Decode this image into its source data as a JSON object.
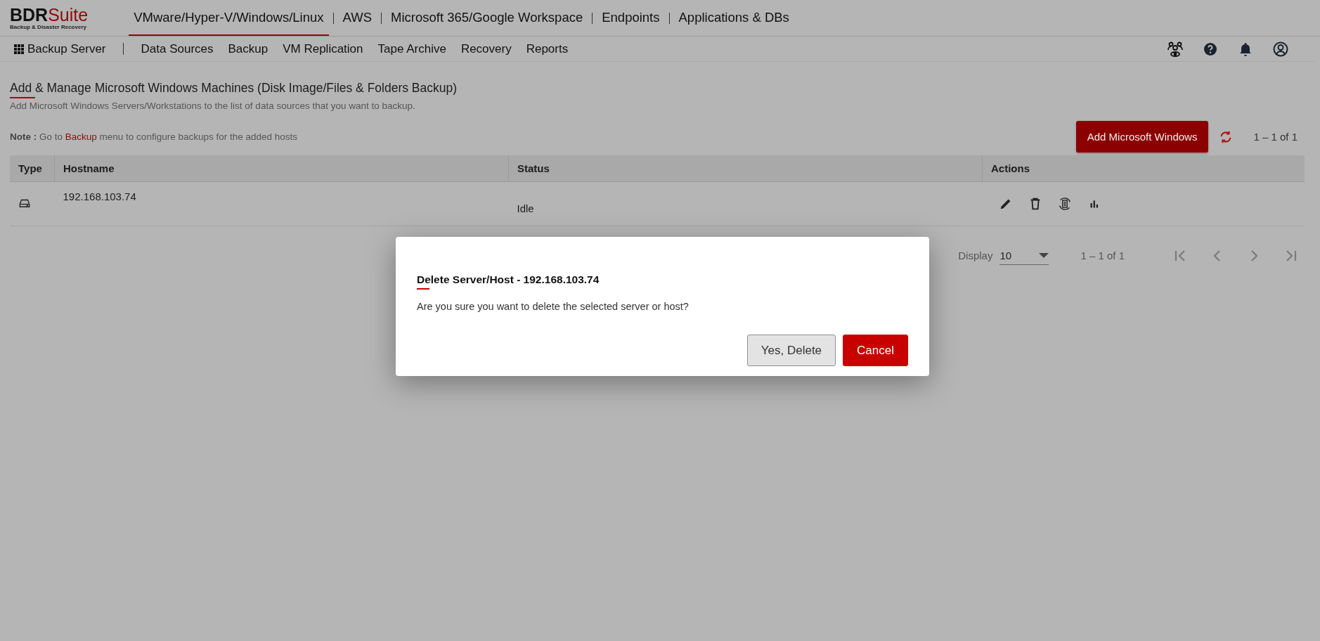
{
  "brand": {
    "name_dark": "BDR",
    "name_red": "Suite",
    "tagline": "Backup & Disaster Recovery"
  },
  "top_nav": [
    {
      "label": "VMware/Hyper-V/Windows/Linux",
      "selected": true
    },
    {
      "label": "AWS",
      "selected": false
    },
    {
      "label": "Microsoft 365/Google Workspace",
      "selected": false
    },
    {
      "label": "Endpoints",
      "selected": false
    },
    {
      "label": "Applications & DBs",
      "selected": false
    }
  ],
  "sub_nav": {
    "app_label": "Backup Server",
    "items": [
      "Data Sources",
      "Backup",
      "VM Replication",
      "Tape Archive",
      "Recovery",
      "Reports"
    ]
  },
  "page": {
    "title": "Add & Manage Microsoft Windows Machines (Disk Image/Files & Folders Backup)",
    "subtitle": "Add Microsoft Windows Servers/Workstations to the list of data sources that you want to backup.",
    "note_prefix": "**Note :** Go to",
    "note_link": "Backup",
    "note_suffix": "menu to configure backups for the added hosts",
    "add_button": "Add Microsoft Windows",
    "range_top": "1 – 1 of 1"
  },
  "table": {
    "columns": [
      "Type",
      "Hostname",
      "Status",
      "Actions"
    ],
    "rows": [
      {
        "hostname": "192.168.103.74",
        "status": "Idle"
      }
    ]
  },
  "pagination": {
    "display_label": "Display",
    "page_size": "10",
    "range": "1 – 1 of 1"
  },
  "dialog": {
    "title": "Delete Server/Host - 192.168.103.74",
    "message": "Are you sure you want to delete the selected server or host?",
    "buttons": [
      {
        "label": "Yes, Delete",
        "kind": "secondary"
      },
      {
        "label": "Cancel",
        "kind": "primary"
      }
    ]
  }
}
